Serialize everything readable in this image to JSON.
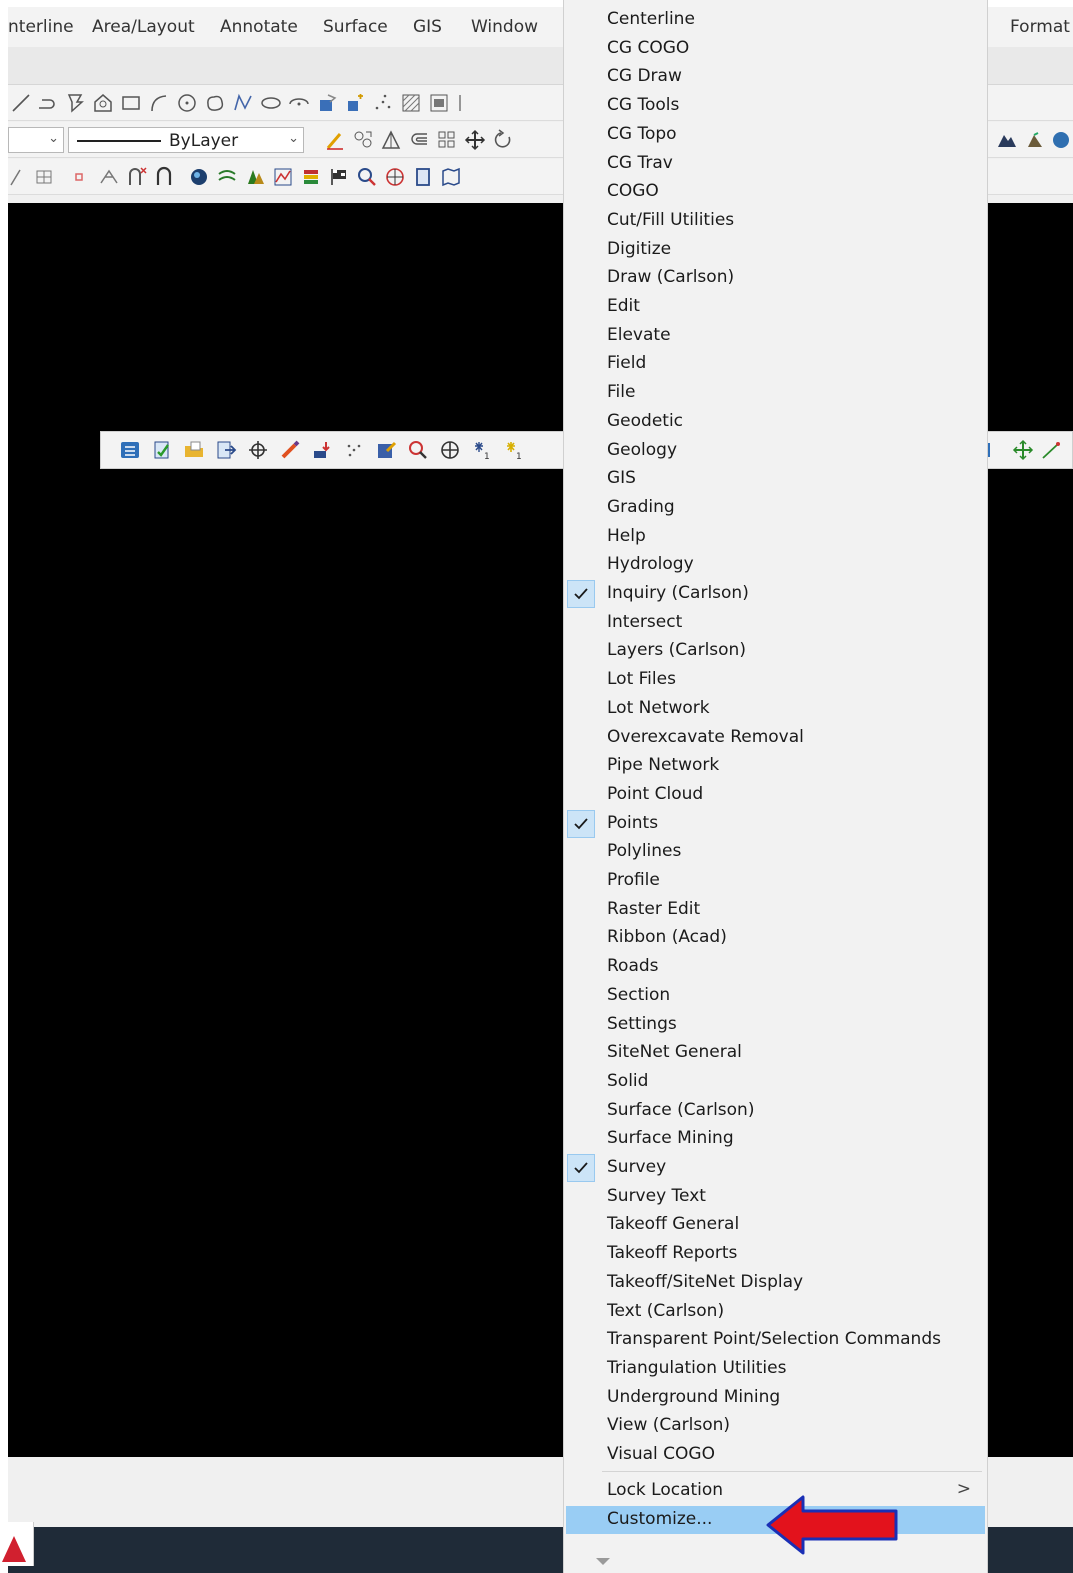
{
  "menubar": {
    "items": [
      "nterline",
      "Area/Layout",
      "Annotate",
      "Surface",
      "GIS",
      "Window"
    ],
    "right_item": "Format"
  },
  "toolbar": {
    "linetype_value": "ByLayer"
  },
  "menu": {
    "items": [
      {
        "label": "Centerline",
        "checked": false
      },
      {
        "label": "CG COGO",
        "checked": false
      },
      {
        "label": "CG Draw",
        "checked": false
      },
      {
        "label": "CG Tools",
        "checked": false
      },
      {
        "label": "CG Topo",
        "checked": false
      },
      {
        "label": "CG Trav",
        "checked": false
      },
      {
        "label": "COGO",
        "checked": false
      },
      {
        "label": "Cut/Fill Utilities",
        "checked": false
      },
      {
        "label": "Digitize",
        "checked": false
      },
      {
        "label": "Draw (Carlson)",
        "checked": false
      },
      {
        "label": "Edit",
        "checked": false
      },
      {
        "label": "Elevate",
        "checked": false
      },
      {
        "label": "Field",
        "checked": false
      },
      {
        "label": "File",
        "checked": false
      },
      {
        "label": "Geodetic",
        "checked": false
      },
      {
        "label": "Geology",
        "checked": false
      },
      {
        "label": "GIS",
        "checked": false
      },
      {
        "label": "Grading",
        "checked": false
      },
      {
        "label": "Help",
        "checked": false
      },
      {
        "label": "Hydrology",
        "checked": false
      },
      {
        "label": "Inquiry (Carlson)",
        "checked": true
      },
      {
        "label": "Intersect",
        "checked": false
      },
      {
        "label": "Layers (Carlson)",
        "checked": false
      },
      {
        "label": "Lot Files",
        "checked": false
      },
      {
        "label": "Lot Network",
        "checked": false
      },
      {
        "label": "Overexcavate Removal",
        "checked": false
      },
      {
        "label": "Pipe Network",
        "checked": false
      },
      {
        "label": "Point Cloud",
        "checked": false
      },
      {
        "label": "Points",
        "checked": true
      },
      {
        "label": "Polylines",
        "checked": false
      },
      {
        "label": "Profile",
        "checked": false
      },
      {
        "label": "Raster Edit",
        "checked": false
      },
      {
        "label": "Ribbon (Acad)",
        "checked": false
      },
      {
        "label": "Roads",
        "checked": false
      },
      {
        "label": "Section",
        "checked": false
      },
      {
        "label": "Settings",
        "checked": false
      },
      {
        "label": "SiteNet General",
        "checked": false
      },
      {
        "label": "Solid",
        "checked": false
      },
      {
        "label": "Surface (Carlson)",
        "checked": false
      },
      {
        "label": "Surface Mining",
        "checked": false
      },
      {
        "label": "Survey",
        "checked": true
      },
      {
        "label": "Survey Text",
        "checked": false
      },
      {
        "label": "Takeoff General",
        "checked": false
      },
      {
        "label": "Takeoff Reports",
        "checked": false
      },
      {
        "label": "Takeoff/SiteNet Display",
        "checked": false
      },
      {
        "label": "Text (Carlson)",
        "checked": false
      },
      {
        "label": "Transparent Point/Selection Commands",
        "checked": false
      },
      {
        "label": "Triangulation Utilities",
        "checked": false
      },
      {
        "label": "Underground Mining",
        "checked": false
      },
      {
        "label": "View (Carlson)",
        "checked": false
      },
      {
        "label": "Visual COGO",
        "checked": false
      }
    ],
    "lock_location": "Lock Location",
    "lock_location_arrow": ">",
    "customize": "Customize..."
  },
  "colors": {
    "highlight": "#99cdf4",
    "check_bg": "#cce4f7",
    "arrow_red": "#e3121c",
    "arrow_outline": "#1a2fb5",
    "canvas": "#000000"
  }
}
